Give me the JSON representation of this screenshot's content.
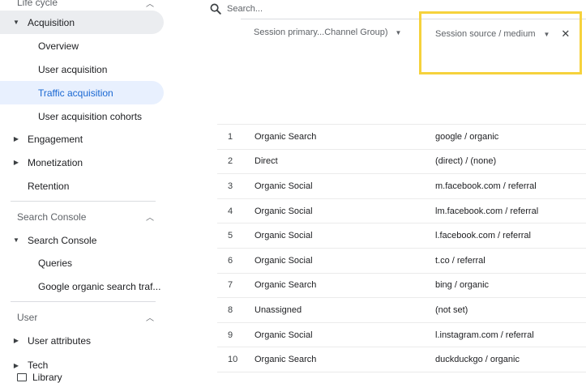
{
  "sidebar": {
    "top_cut_label": "Life cycle",
    "items": [
      {
        "label": "Acquisition",
        "expanded": true
      },
      {
        "label": "Overview"
      },
      {
        "label": "User acquisition"
      },
      {
        "label": "Traffic acquisition",
        "selected": true
      },
      {
        "label": "User acquisition cohorts"
      },
      {
        "label": "Engagement"
      },
      {
        "label": "Monetization"
      },
      {
        "label": "Retention"
      }
    ],
    "search_console_section": "Search Console",
    "search_console_group": "Search Console",
    "search_console_items": [
      "Queries",
      "Google organic search traf..."
    ],
    "user_section": "User",
    "user_items": [
      "User attributes",
      "Tech"
    ],
    "library_label": "Library"
  },
  "search": {
    "placeholder": "Search..."
  },
  "dimensions": {
    "primary": "Session primary...Channel Group)",
    "secondary": "Session source / medium"
  },
  "table": {
    "rows": [
      {
        "n": "1",
        "channel": "Organic Search",
        "source": "google / organic"
      },
      {
        "n": "2",
        "channel": "Direct",
        "source": "(direct) / (none)"
      },
      {
        "n": "3",
        "channel": "Organic Social",
        "source": "m.facebook.com / referral"
      },
      {
        "n": "4",
        "channel": "Organic Social",
        "source": "lm.facebook.com / referral"
      },
      {
        "n": "5",
        "channel": "Organic Social",
        "source": "l.facebook.com / referral"
      },
      {
        "n": "6",
        "channel": "Organic Social",
        "source": "t.co / referral"
      },
      {
        "n": "7",
        "channel": "Organic Search",
        "source": "bing / organic"
      },
      {
        "n": "8",
        "channel": "Unassigned",
        "source": "(not set)"
      },
      {
        "n": "9",
        "channel": "Organic Social",
        "source": "l.instagram.com / referral"
      },
      {
        "n": "10",
        "channel": "Organic Search",
        "source": "duckduckgo / organic"
      }
    ]
  },
  "colors": {
    "highlight": "#f6d23c",
    "selected_text": "#1967d2",
    "selected_bg": "#e8f0fe"
  }
}
